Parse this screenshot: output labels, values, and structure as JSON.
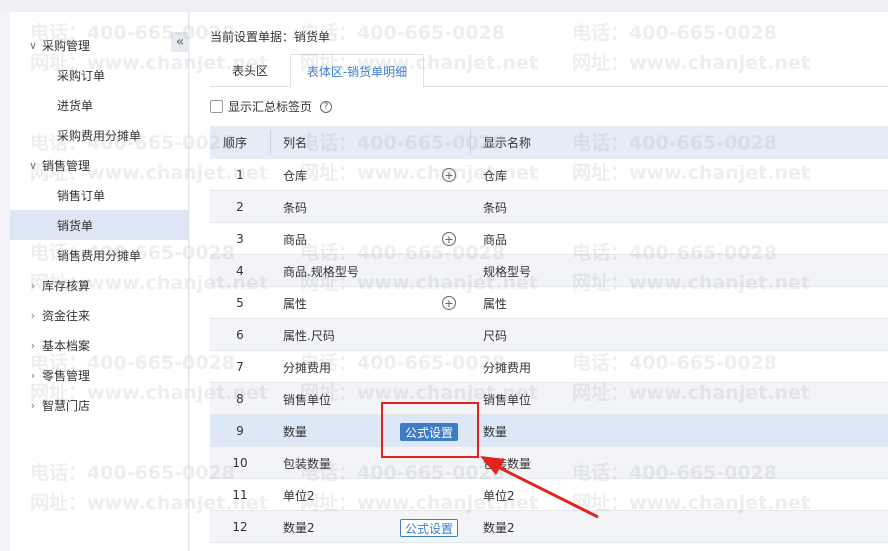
{
  "sidebar": {
    "groups": [
      {
        "label": "采购管理",
        "expanded": true,
        "items": [
          "采购订单",
          "进货单",
          "采购费用分摊单"
        ]
      },
      {
        "label": "销售管理",
        "expanded": true,
        "items": [
          "销售订单",
          "销货单",
          "销售费用分摊单"
        ]
      },
      {
        "label": "库存核算",
        "expanded": false
      },
      {
        "label": "资金往来",
        "expanded": false
      },
      {
        "label": "基本档案",
        "expanded": false
      },
      {
        "label": "零售管理",
        "expanded": false
      },
      {
        "label": "智慧门店",
        "expanded": false
      }
    ],
    "active_item": "销货单",
    "collapse_icon": "double-chevron-left-icon"
  },
  "main": {
    "doc_title": "当前设置单据：销货单",
    "tabs": [
      {
        "label": "表头区",
        "active": false
      },
      {
        "label": "表体区-销货单明细",
        "active": true
      }
    ],
    "summary_checkbox_label": "显示汇总标签页",
    "summary_checked": false,
    "help_icon": "?"
  },
  "table": {
    "headers": {
      "seq": "顺序",
      "column": "列名",
      "display": "显示名称"
    },
    "rows": [
      {
        "seq": "1",
        "column": "仓库",
        "display": "仓库",
        "plus": true
      },
      {
        "seq": "2",
        "column": "条码",
        "display": "条码"
      },
      {
        "seq": "3",
        "column": "商品",
        "display": "商品",
        "plus": true
      },
      {
        "seq": "4",
        "column": "商品.规格型号",
        "display": "规格型号"
      },
      {
        "seq": "5",
        "column": "属性",
        "display": "属性",
        "plus": true
      },
      {
        "seq": "6",
        "column": "属性.尺码",
        "display": "尺码"
      },
      {
        "seq": "7",
        "column": "分摊费用",
        "display": "分摊费用"
      },
      {
        "seq": "8",
        "column": "销售单位",
        "display": "销售单位"
      },
      {
        "seq": "9",
        "column": "数量",
        "display": "数量",
        "formula": "公式设置",
        "formula_style": "filled",
        "selected": true
      },
      {
        "seq": "10",
        "column": "包装数量",
        "display": "包装数量"
      },
      {
        "seq": "11",
        "column": "单位2",
        "display": "单位2"
      },
      {
        "seq": "12",
        "column": "数量2",
        "display": "数量2",
        "formula": "公式设置",
        "formula_style": "outline"
      }
    ],
    "plus_glyph": "+"
  },
  "watermark": {
    "phone": "电话：400-665-0028",
    "site": "网址：www.chanjet.net"
  },
  "colors": {
    "accent": "#3f7cc8",
    "selected_row": "#dce8f7",
    "annotation": "#e1251b"
  }
}
